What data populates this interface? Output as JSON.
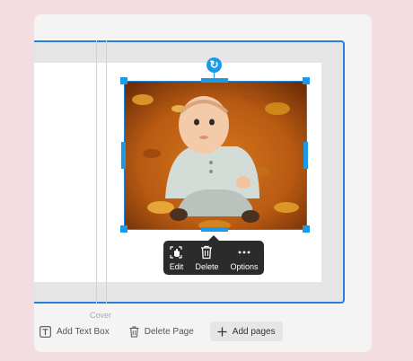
{
  "canvas": {
    "cover_label": "Cover"
  },
  "selection": {
    "rotate_icon": "rotate-icon"
  },
  "toolbar": {
    "edit_label": "Edit",
    "delete_label": "Delete",
    "options_label": "Options",
    "icons": [
      "hand-icon",
      "trash-icon",
      "ellipsis-icon"
    ]
  },
  "bottom_bar": {
    "add_text_box": "Add Text Box",
    "delete_page": "Delete Page",
    "add_pages": "Add pages",
    "icons": [
      "text-box-icon",
      "trash-icon",
      "plus-icon"
    ]
  },
  "colors": {
    "accent": "#1a9ae8",
    "frame_border": "#2b7fd9",
    "toolbar_bg": "#2b2b2b",
    "background": "#f3dde0"
  }
}
